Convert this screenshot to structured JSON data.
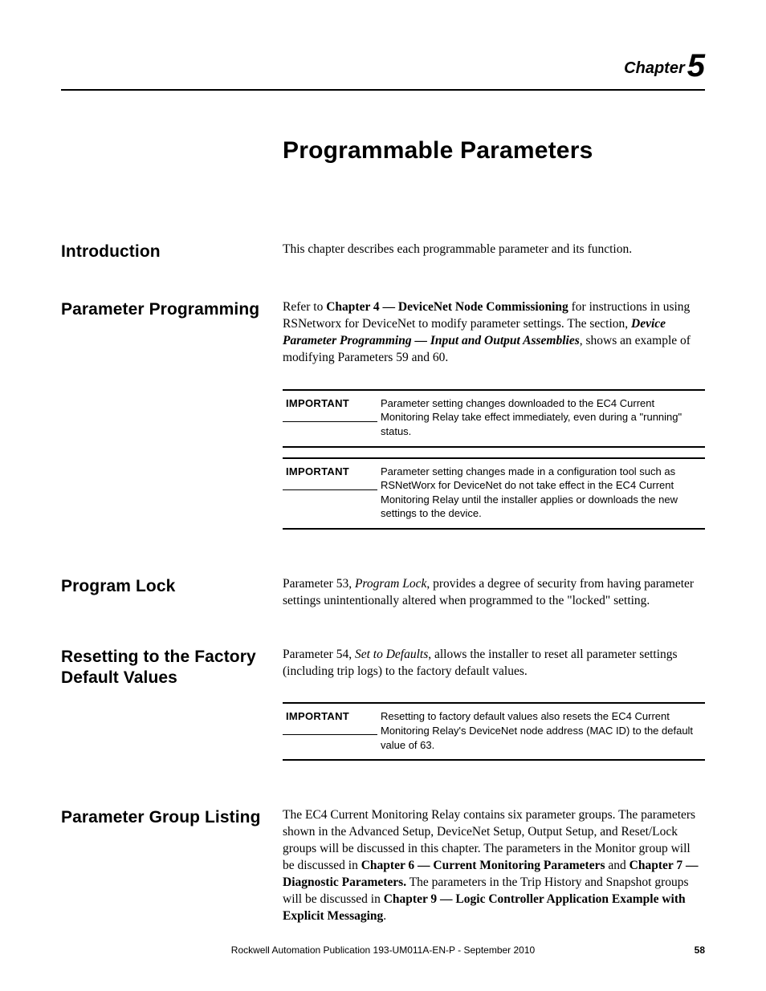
{
  "chapter": {
    "label": "Chapter",
    "number": "5",
    "title": "Programmable Parameters"
  },
  "sections": {
    "introduction": {
      "heading": "Introduction",
      "body": "This chapter describes each programmable parameter and its function."
    },
    "parameter_programming": {
      "heading": "Parameter Programming",
      "body_prefix": "Refer to ",
      "body_bold1": "Chapter 4 — DeviceNet Node Commissioning",
      "body_mid1": " for instructions in using RSNetworx for DeviceNet to modify parameter settings. The section, ",
      "body_bolditalic": "Device Parameter Programming — Input and Output Assemblies",
      "body_suffix": ", shows an example of modifying Parameters 59 and 60.",
      "important1": {
        "label": "IMPORTANT",
        "text": "Parameter setting changes downloaded to the EC4 Current Monitoring Relay take effect immediately, even during a \"running\" status."
      },
      "important2": {
        "label": "IMPORTANT",
        "text": "Parameter setting changes made in a configuration tool such as RSNetWorx for DeviceNet do not take effect in the EC4 Current Monitoring Relay until the installer applies or downloads the new settings to the device."
      }
    },
    "program_lock": {
      "heading": "Program Lock",
      "body_prefix": "Parameter 53, ",
      "body_italic": "Program Lock",
      "body_suffix": ", provides a degree of security from having parameter settings unintentionally altered when programmed to the \"locked\" setting."
    },
    "resetting": {
      "heading": "Resetting to the Factory Default Values",
      "body_prefix": "Parameter 54, ",
      "body_italic": "Set to Defaults",
      "body_suffix": ", allows the installer to reset all parameter settings (including trip logs) to the factory default values.",
      "important": {
        "label": "IMPORTANT",
        "text": "Resetting to factory default values also resets the EC4 Current Monitoring Relay's DeviceNet node address (MAC ID) to the default value of 63."
      }
    },
    "group_listing": {
      "heading": "Parameter Group Listing",
      "p1": "The EC4 Current Monitoring Relay contains six parameter groups. The parameters shown in the Advanced Setup, DeviceNet Setup, Output Setup, and Reset/Lock groups will be discussed in this chapter. The parameters in the Monitor group will be discussed in ",
      "b1": "Chapter 6 — Current Monitoring Parameters",
      "p2": " and ",
      "b2": "Chapter 7 — Diagnostic Parameters.",
      "p3": " The parameters in the Trip History and Snapshot groups will be discussed in ",
      "b3": "Chapter 9 — Logic Controller Application Example with Explicit Messaging",
      "p4": "."
    }
  },
  "footer": {
    "text": "Rockwell Automation Publication 193-UM011A-EN-P - September 2010",
    "page": "58"
  }
}
